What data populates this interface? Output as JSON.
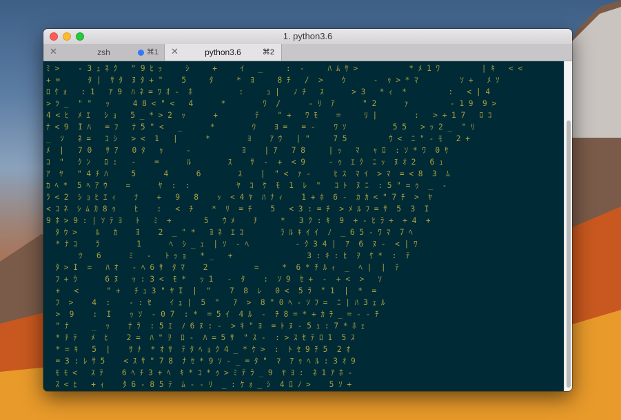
{
  "window": {
    "title": "1. python3.6"
  },
  "tabs": [
    {
      "label": "zsh",
      "shortcut": "⌘1",
      "active": false,
      "activity_dot": true
    },
    {
      "label": "python3.6",
      "shortcut": "⌘2",
      "active": true,
      "activity_dot": false
    }
  ],
  "icons": {
    "tab_close": "✕"
  },
  "colors": {
    "terminal_bg": "#002b36",
    "glyph": "#a8a040",
    "highlight": "#ffffff",
    "activity_dot": "#3478f6"
  },
  "terminal": {
    "lines": [
      "ﾐ >    - 3 ｭ ﾈ ｸ   \" 9 ﾋ ｯ     ｼ     +     ｲ   _     :  -     ﾊ ﾑ ｻ >           * ﾒ 1 ﾜ         | ｷ   < <",
      "+ =      ﾀ |  ｻ ﾀ  ﾇ ﾀ + \"    5     ﾀ     *  ﾖ     8 ﾁ   /  >    ｳ      -  ｩ > * ﾏ         ｿ +   ﾒ ｿ",
      "ﾛ ｹ ｫ   : 1   ｱ 9  ﾊ ﾈ = ﾜ ｵ -  ﾎ          :     ｭ |   ﾉ ﾁ   ｽ      > 3   * ｨ  *         :   < | 4",
      "> ﾂ _  \" \"   ｯ     4 8 < \" <   4      *        ﾜ  /      - ﾘ  ｱ      \" 2      ｧ         - 1 9  9 >",
      "4 < ﾋ  ﾒ ｴ   ｼ ｮ   5 _ * > 2  ｯ      +        ﾃ    \" +   ﾜ ﾓ    =     ﾘ |        :   > + 1 7   ﾛ ｺ",
      "ﾅ < 9  I ﾊ   = ﾌ   ﾅ 5 \" <   _      *        ｳ    ﾖ =   = -    ﾜ ｿ          5 5   > ｯ 2 _  \" ﾘ",
      "_  ｿ   ﾈ =   ｺ ｼ   > <  1   |      *        ﾖ    ｱ ｳ   | \"     7 5         ｳ <  ﾆ \" - ﾓ   2 +",
      "ﾒ  |   7 0   ｻ ｱ   0 ﾀ   ｩ     -           ﾖ    | ｱ   7 8     | ｯ   ﾏ   ｬ ﾛ  : ｿ * ﾜ  0 ｻ",
      "ｺ  \"   ｸ ﾝ   ﾛ :   -    =      ﾙ        ｽ    ｻ  -  +  < 9     - ｩ  ｴ ｸ  ﾆ ｯ  ﾇ ｵ 2   6 ｭ",
      "ｱ  ﾔ   \" 4 ﾁ ﾊ     5      4      6        ｽ    |  \" <  ｧ -     ﾋ ｽ  ﾏ ｲ  > ﾏ  = < 8  3  ﾑ",
      "ｶ ﾍ *  5 ﾍ ｱ ｳ    =      ﾔ  :  :          ﾔ  ｺ  ｹ  ﾓ  1  ﾚ  \"   ｺ ﾄ  ﾇ ﾆ  : 5 \" = ｩ  _  -",
      "ﾗ < 2  ｼ ｮ ﾋ ｴ ｨ    ﾅ    +   9   8    ｯ  < 4 ﾔ  ﾊ ﾅ ｨ    1 + ﾎ  6 -  ｶ ｶ < \" 7 ﾁ  >  ﾔ",
      "< ｺ ﾈ  ｼ ﾑ ｶ 8 ｩ    ﾋ    :   <  ﾁ    *  ﾘ  = ﾁ    5   < 3 : = ﾁ  > ﾒ ﾙ ﾌ = ｻ  5  3  I",
      "9 ﾎ > 9 : | ｿ ﾃ ﾖ   ﾄ   ﾐ  +       5   ｳ ﾒ    ﾁ     *   3 ｸ : ｷ  9  + - ﾋ ﾗ +  + 4  +",
      "  ﾀ ｳ >    ﾙ   ｶ    ﾖ    2  _ \" *   ﾖ ﾈ  ｴ ｺ        ﾗ ﾙ ｷ ｲ ｲ  ﾉ  _ 6 5 - ﾜ ﾏ  7 ﾍ",
      "  * ﾅ ｺ    ﾗ        1      ﾍ  ｼ _ ｭ  | ｿ  - ﾍ          - ｸ 3 4 |  ｱ  6  ﾇ -  < | ﾜ",
      "       ﾂ   6      ﾐ   -   ﾄ ｯ ｮ   * _   +                3 : ｷ : ﾋ  ｦ  ｹ *  :  ﾃ",
      "  ﾀ > I  =   ﾊ ｵ   - ﾍ 6 ｻ  ﾀ ﾏ    2          =     *  6 * ﾁ ﾙ ｨ  _  ﾍ |  |  ﾃ",
      "  ﾌ + ｳ      6 ﾇ   ｯ : 3 <  ﾓ *   ｯ 1   -  ﾀ    :  ｿ 9  ｾ +  -  + <  >   ｿ",
      "  +   <      \" +   ﾁ ｭ 3 \" ﾔ I  |  \"    7  8  ﾚ   0 <  5 ﾗ  \" 1  |  *  =",
      "  ﾌ  >    4  :    - : ｾ    ｲ ｪ |  5  \"   ｱ  >  8 \" 0 ﾍ - ｿ ﾌ =  ﾆ | ﾊ 3 ｪ ﾙ",
      "  >  9    :  I    ｯ ｿ  - 0 7  : *  = 5 ｲ  4 ﾙ  -  ﾁ 8 = * + ｶ ﾁ _ = - - ﾁ",
      "  \" ﾅ     _  ｯ    ﾅ ﾗ  : 5 ｴ  ﾉ 6 ﾇ : -  > ｷ \" ﾖ  = ﾄ ﾇ - 5 ｭ : 7 * ﾎ ｪ",
      "  * ﾁ ﾃ   ﾒ  ﾋ    2 =  ﾊ \" ｦ  ﾛ -  ﾊ = 5 ｻ  \" ｽ -  : > ｽ ｾ ﾃ ﾛ 1  5 ｽ",
      "  * = ｷ   5  |    ｻ ﾅ  * ｵ ｻ  ﾃ ﾀ ﾍ ｮ ｸ 4 _ * ｹ >  :  ﾄ ｾ 9 ﾁ 5  2 ｵ",
      "  = 3 : ﾚ ｻ 5    < ｽ ｻ \" 7 8  ﾅ ｾ * 9 ｿ - _ = ﾀ \"  ﾏ  ｱ ｩ ﾍ ﾙ : 3 ｵ 9",
      "  ﾓ ﾓ <   ｽ ﾃ    6 ﾍ ﾁ 3 + ﾍ  ｷ * ｺ * ｩ > ﾐ ﾃ ﾗ _ 9  ﾔ ﾖ :  ﾈ 1 ｱ ﾎ -",
      "  ｽ < ﾋ   + ｨ    ﾀ 6 - 8 5 ﾃ  ﾑ - - ﾘ  _ : ｹ ｫ _ ｼ  4 ﾛ ﾉ >    5 ｿ +"
    ]
  }
}
